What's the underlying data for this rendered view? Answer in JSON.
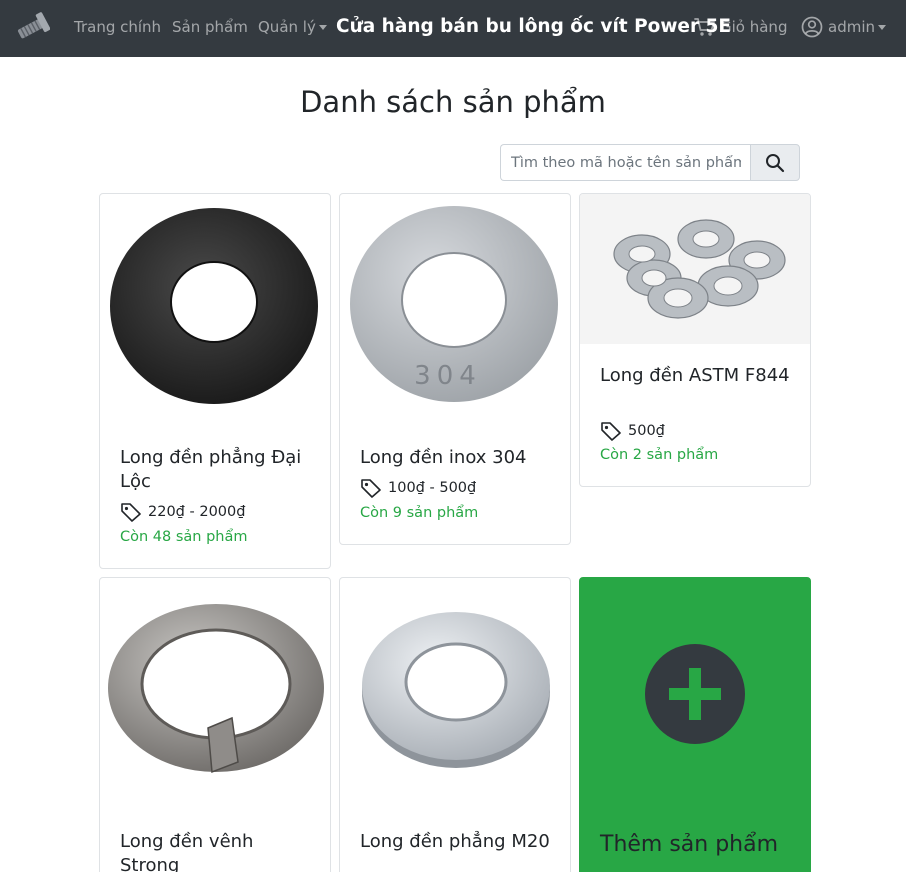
{
  "navbar": {
    "links": [
      "Trang chính",
      "Sản phẩm"
    ],
    "manage_label": "Quản lý",
    "brand": "Cửa hàng bán bu lông ốc vít Power 5E",
    "cart_label": "Giỏ hàng",
    "user_label": "admin"
  },
  "page": {
    "title": "Danh sách sản phẩm"
  },
  "search": {
    "placeholder": "Tìm theo mã hoặc tên sản phẩm",
    "value": ""
  },
  "products": [
    {
      "name": "Long đền phẳng Đại Lộc",
      "price": "220₫ - 2000₫",
      "stock": "Còn 48 sản phẩm",
      "image_icon": "black-flat-washer-image"
    },
    {
      "name": "Long đền inox 304",
      "price": "100₫ - 500₫",
      "stock": "Còn 9 sản phẩm",
      "image_icon": "steel-304-washer-image",
      "image_marking": "304"
    },
    {
      "name": "Long đền ASTM F844",
      "price": "500₫",
      "stock": "Còn 2 sản phẩm",
      "image_icon": "washer-pile-image"
    },
    {
      "name": "Long đền vênh Strong",
      "image_icon": "spring-lock-washer-image"
    },
    {
      "name": "Long đền phẳng M20",
      "image_icon": "zinc-flat-washer-image"
    }
  ],
  "add_product": {
    "label": "Thêm sản phẩm"
  },
  "colors": {
    "navbar_bg": "#343a40",
    "accent_green": "#28a745",
    "text_dark": "#212529"
  }
}
